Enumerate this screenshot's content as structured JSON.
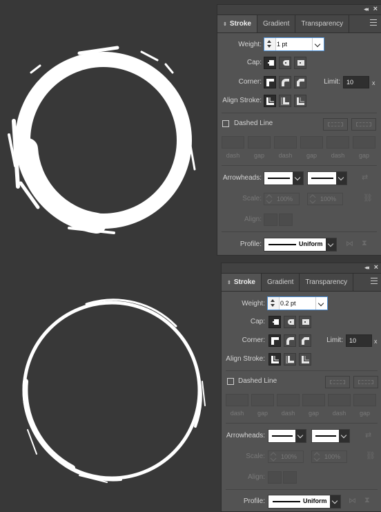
{
  "colors": {
    "background": "#383838",
    "panel": "#535353",
    "accent": "#4b8fd6"
  },
  "panels": [
    {
      "tabs": {
        "stroke": "Stroke",
        "gradient": "Gradient",
        "transparency": "Transparency"
      },
      "weight_label": "Weight:",
      "weight_value": "1 pt",
      "cap_label": "Cap:",
      "corner_label": "Corner:",
      "limit_label": "Limit:",
      "limit_value": "10",
      "limit_unit": "x",
      "align_label": "Align Stroke:",
      "dashed_label": "Dashed Line",
      "dash_labels": [
        "dash",
        "gap",
        "dash",
        "gap",
        "dash",
        "gap"
      ],
      "arrowheads_label": "Arrowheads:",
      "scale_label": "Scale:",
      "scale_values": [
        "100%",
        "100%"
      ],
      "align_arrow_label": "Align:",
      "profile_label": "Profile:",
      "profile_value": "Uniform"
    },
    {
      "tabs": {
        "stroke": "Stroke",
        "gradient": "Gradient",
        "transparency": "Transparency"
      },
      "weight_label": "Weight:",
      "weight_value": "0.2 pt",
      "cap_label": "Cap:",
      "corner_label": "Corner:",
      "limit_label": "Limit:",
      "limit_value": "10",
      "limit_unit": "x",
      "align_label": "Align Stroke:",
      "dashed_label": "Dashed Line",
      "dash_labels": [
        "dash",
        "gap",
        "dash",
        "gap",
        "dash",
        "gap"
      ],
      "arrowheads_label": "Arrowheads:",
      "scale_label": "Scale:",
      "scale_values": [
        "100%",
        "100%"
      ],
      "align_arrow_label": "Align:",
      "profile_label": "Profile:",
      "profile_value": "Uniform"
    }
  ]
}
